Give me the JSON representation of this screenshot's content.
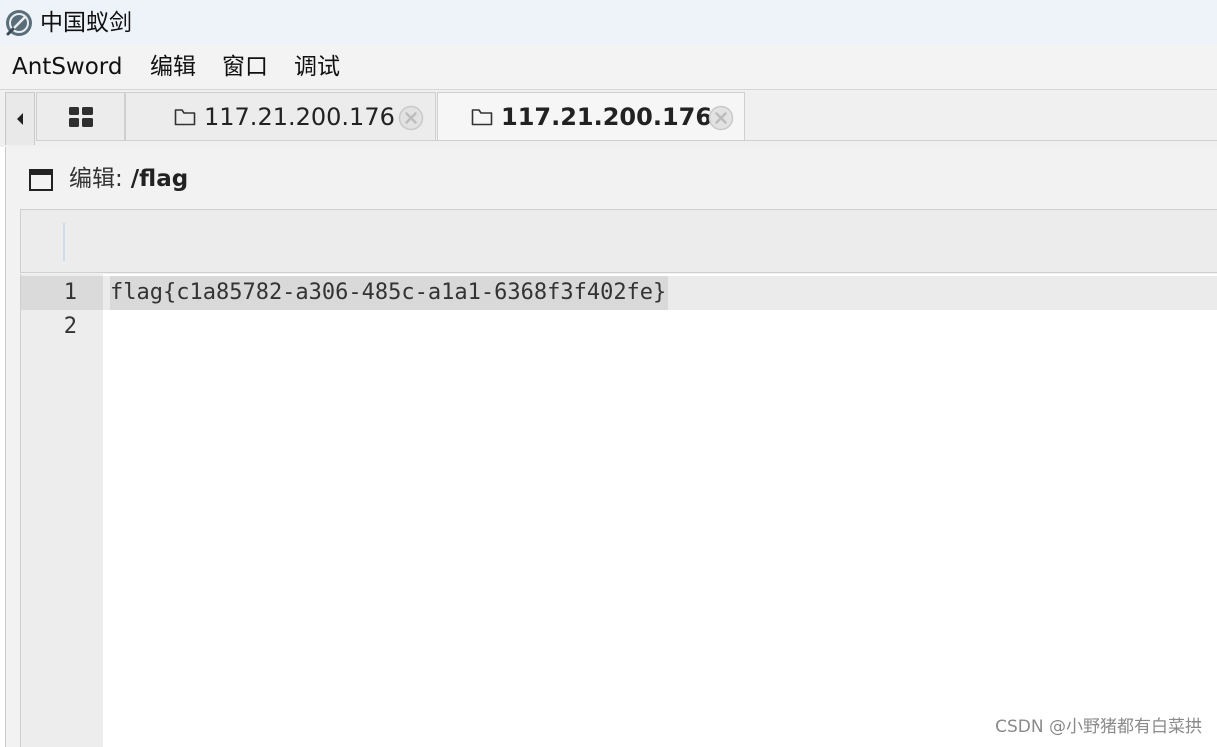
{
  "window": {
    "title": "中国蚁剑",
    "logo_icon": "antsword-logo-icon"
  },
  "menu": {
    "items": [
      "AntSword",
      "编辑",
      "窗口",
      "调试"
    ]
  },
  "tabs": {
    "scroll_left_icon": "triangle-left-icon",
    "grid_icon": "grid-icon",
    "items": [
      {
        "label": "117.21.200.176",
        "icon": "folder-icon",
        "close_icon": "close-circle-icon",
        "active": false
      },
      {
        "label": "117.21.200.176",
        "icon": "folder-icon",
        "close_icon": "close-circle-icon",
        "active": true
      }
    ]
  },
  "editor_panel": {
    "window_icon": "window-icon",
    "title_prefix": "编辑:",
    "title_path": " /flag",
    "lines": [
      {
        "number": "1",
        "text": "flag{c1a85782-a306-485c-a1a1-6368f3f402fe}",
        "active": true
      },
      {
        "number": "2",
        "text": "",
        "active": false
      }
    ]
  },
  "watermark": "CSDN @小野猪都有白菜拱",
  "colors": {
    "titlebar_bg": "#eef3f9",
    "menubar_bg": "#f3f3f3",
    "tab_bg": "#ececec",
    "active_tab_bg": "#f6f6f6",
    "gutter_bg": "#ededed",
    "active_line_bg": "#d9d9d9"
  }
}
